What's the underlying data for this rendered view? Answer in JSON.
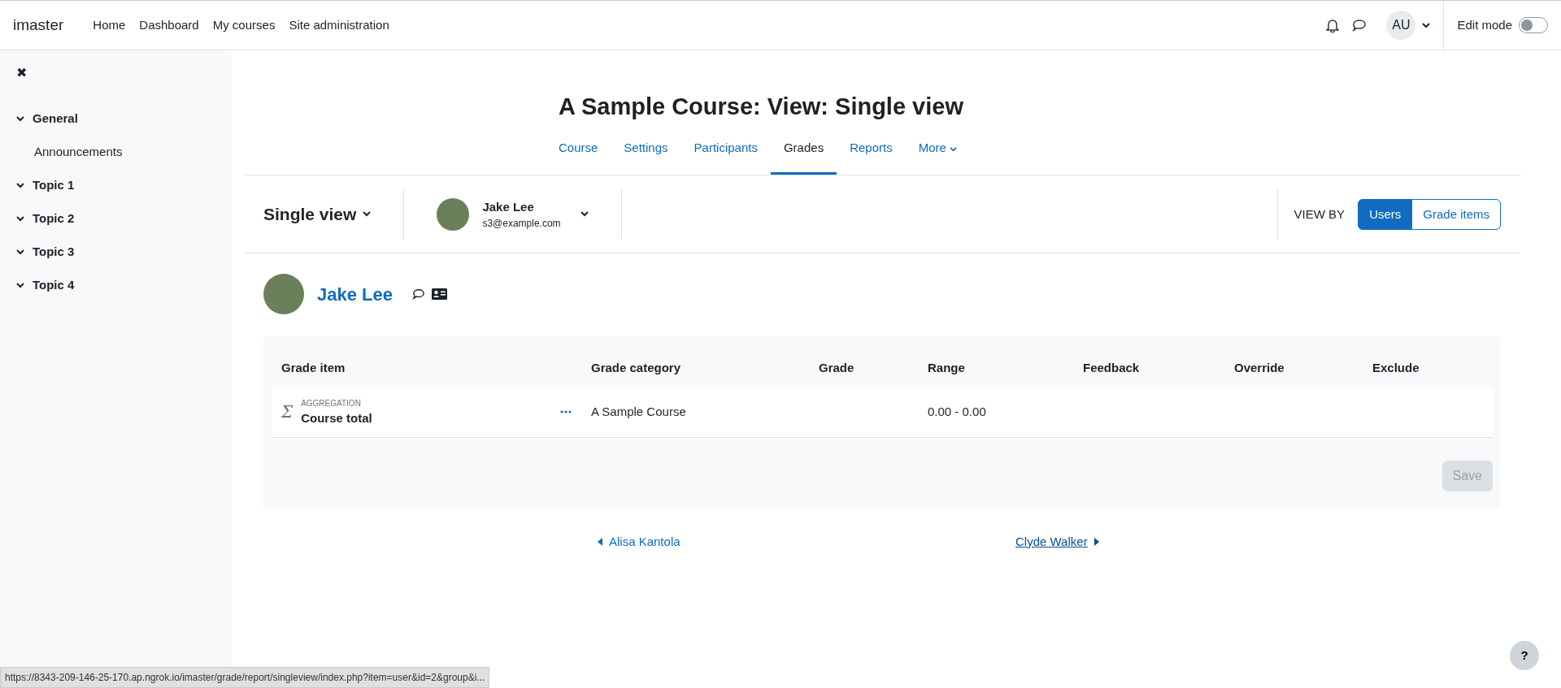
{
  "navbar": {
    "brand": "imaster",
    "links": [
      {
        "label": "Home"
      },
      {
        "label": "Dashboard"
      },
      {
        "label": "My courses"
      },
      {
        "label": "Site administration"
      }
    ],
    "avatar_initials": "AU",
    "edit_mode": {
      "label": "Edit mode",
      "on": false
    }
  },
  "sidebar": {
    "close": "✖",
    "items": [
      {
        "label": "General",
        "expanded": true,
        "children": [
          {
            "label": "Announcements"
          }
        ]
      },
      {
        "label": "Topic 1",
        "expanded": true
      },
      {
        "label": "Topic 2",
        "expanded": true
      },
      {
        "label": "Topic 3",
        "expanded": true
      },
      {
        "label": "Topic 4",
        "expanded": true
      }
    ]
  },
  "page_title": "A Sample Course: View: Single view",
  "tabs": [
    {
      "label": "Course",
      "selected": false
    },
    {
      "label": "Settings",
      "selected": false
    },
    {
      "label": "Participants",
      "selected": false
    },
    {
      "label": "Grades",
      "selected": true
    },
    {
      "label": "Reports",
      "selected": false
    },
    {
      "label": "More",
      "selected": false,
      "kind": "dropdown"
    }
  ],
  "selector": {
    "report": "Single view",
    "user_name": "Jake Lee",
    "user_email": "s3@example.com",
    "view_by_label": "VIEW BY",
    "view_by": [
      {
        "label": "Users",
        "selected": true
      },
      {
        "label": "Grade items",
        "selected": false
      }
    ]
  },
  "user_heading": {
    "name": "Jake Lee"
  },
  "table": {
    "columns": [
      "Grade item",
      "Grade category",
      "Grade",
      "Range",
      "Feedback",
      "Override",
      "Exclude"
    ],
    "rows": [
      {
        "icon": "Σ",
        "item_type": "AGGREGATION",
        "item": "Course total",
        "category": "A Sample Course",
        "range": "0.00 - 0.00"
      }
    ],
    "save": {
      "label": "Save",
      "disabled": true
    }
  },
  "pager": {
    "previous": "Alisa Kantola",
    "next": "Clyde Walker"
  },
  "help": "?",
  "status_bar": "https://8343-209-146-25-170.ap.ngrok.io/imaster/grade/report/singleview/index.php?item=user&id=2&group&i..."
}
